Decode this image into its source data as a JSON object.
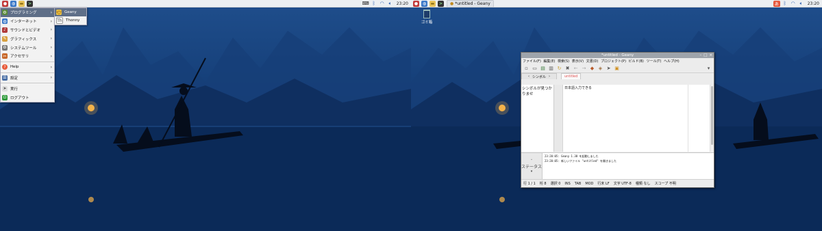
{
  "colors": {
    "panel_bg": "#eceff2",
    "menu_highlight": "#5f6f88",
    "tab_red": "#e05050"
  },
  "left_screen": {
    "panel": {
      "icons": [
        "raspberry-icon",
        "globe-icon",
        "folder-icon",
        "terminal-icon"
      ],
      "tray_icons": [
        "keyboard-icon",
        "bluetooth-icon",
        "wifi-icon",
        "volume-icon"
      ],
      "clock": "23:20"
    },
    "menu": {
      "items": [
        {
          "label": "プログラミング",
          "icon": "programming-icon",
          "selected": true
        },
        {
          "label": "インターネット",
          "icon": "globe-icon"
        },
        {
          "label": "サウンドとビデオ",
          "icon": "sound-video-icon"
        },
        {
          "label": "グラフィックス",
          "icon": "graphics-icon"
        },
        {
          "label": "システムツール",
          "icon": "system-tools-icon"
        },
        {
          "label": "アクセサリ",
          "icon": "accessories-icon"
        },
        {
          "label": "Help",
          "icon": "help-icon"
        },
        {
          "label": "設定",
          "icon": "settings-icon"
        },
        {
          "label": "実行",
          "icon": "run-icon"
        },
        {
          "label": "ログアウト",
          "icon": "logout-icon"
        }
      ],
      "submenu": [
        {
          "label": "Geany",
          "icon": "geany-icon",
          "highlight": true
        },
        {
          "label": "Thonny",
          "icon": "thonny-icon"
        }
      ]
    }
  },
  "right_screen": {
    "panel": {
      "icons": [
        "raspberry-icon",
        "globe-icon",
        "folder-icon",
        "terminal-icon"
      ],
      "task_button": "*untitled - Geany",
      "tray_icons": [
        "ime-icon",
        "bluetooth-icon",
        "wifi-icon",
        "volume-icon"
      ],
      "ime_label": "あ",
      "clock": "23:20"
    },
    "desktop_icon": {
      "label": "ゴミ箱"
    },
    "geany": {
      "title": "*untitled - Geany",
      "menubar": [
        "ファイル(F)",
        "編集(E)",
        "検索(S)",
        "表示(V)",
        "文書(D)",
        "プロジェクト(P)",
        "ビルド(B)",
        "ツール(T)",
        "ヘルプ(H)"
      ],
      "sidebar_tab": "シンボル",
      "editor_tab": "untitled",
      "sidebar_text": "シンボルが見つかりませ",
      "editor_text": "日本語入力できる",
      "message_tab": "ステータス",
      "messages": [
        "23:20:05: Geany 1.38 を起動しました",
        "23:20:05: 新しいファイル \"untitled\" を開きました"
      ],
      "status": {
        "line": "行 1 / 1",
        "col": "桁 8",
        "sel": "選択 0",
        "ins": "INS",
        "tab": "TAB",
        "mod": "MOD",
        "eol": "行末 LF",
        "enc": "文字 UTF-8",
        "type": "種類 なし",
        "scope": "スコープ 不明"
      }
    }
  }
}
